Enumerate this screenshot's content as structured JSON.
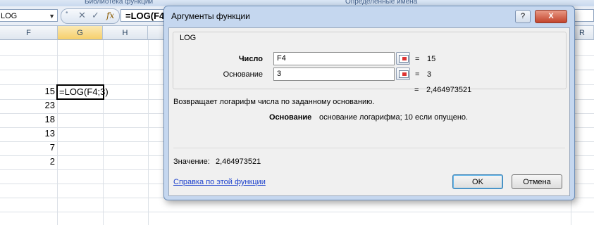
{
  "ribbon": {
    "group1": "Библиотека функций",
    "group2": "Определенные имена"
  },
  "formula_bar": {
    "name_box": "LOG",
    "cancel": "✕",
    "enter": "✓",
    "fx": "fx",
    "formula": "=LOG(F4"
  },
  "columns": [
    "F",
    "G",
    "H",
    "R"
  ],
  "cells": {
    "f_values": [
      "15",
      "23",
      "18",
      "13",
      "7",
      "2"
    ],
    "active_cell": "=LOG(F4;3)"
  },
  "dialog": {
    "title": "Аргументы функции",
    "help_button": "?",
    "close_button": "X",
    "function_name": "LOG",
    "args": [
      {
        "label": "Число",
        "value": "F4",
        "result": "15"
      },
      {
        "label": "Основание",
        "value": "3",
        "result": "3"
      }
    ],
    "eq_sign": "=",
    "formula_result": "2,464973521",
    "description": "Возвращает логарифм числа по заданному основанию.",
    "arg_help_name": "Основание",
    "arg_help_text": "основание логарифма; 10 если опущено.",
    "value_label": "Значение:",
    "value": "2,464973521",
    "help_link": "Справка по этой функции",
    "ok": "OK",
    "cancel": "Отмена"
  }
}
